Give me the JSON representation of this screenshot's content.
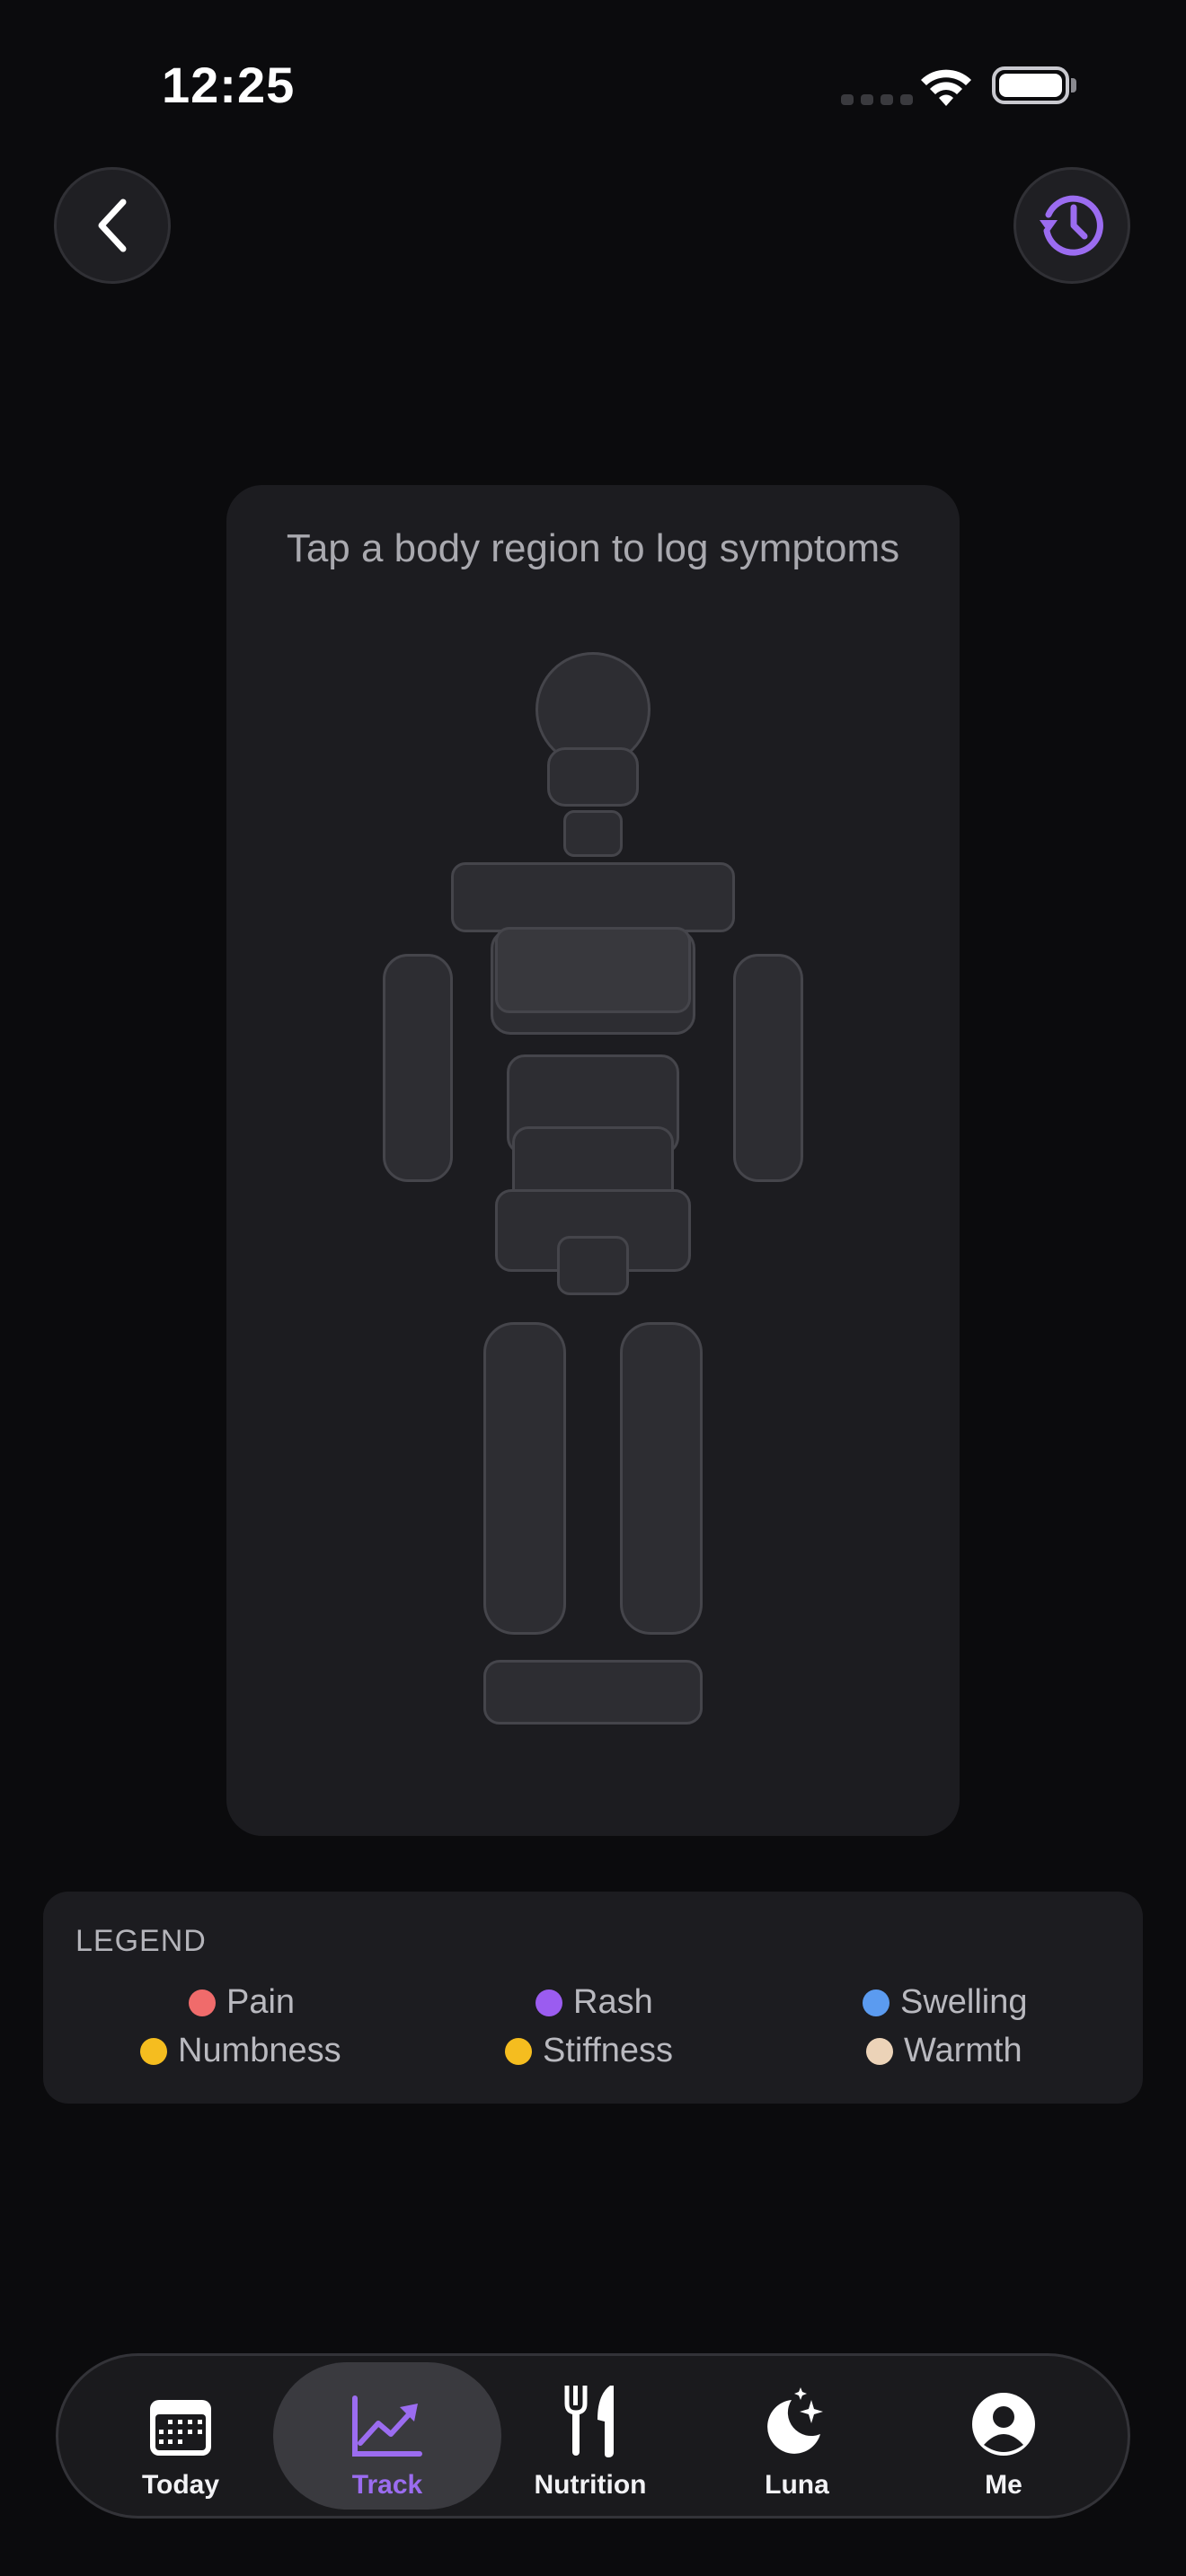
{
  "status": {
    "time": "12:25"
  },
  "header": {
    "back_icon": "chevron-left-icon",
    "history_icon": "history-icon"
  },
  "body_map": {
    "prompt": "Tap a body region to log symptoms"
  },
  "legend": {
    "title": "LEGEND",
    "items": [
      {
        "label": "Pain",
        "color": "#f06b6b"
      },
      {
        "label": "Rash",
        "color": "#9b5cf0"
      },
      {
        "label": "Swelling",
        "color": "#5b9bf0"
      },
      {
        "label": "Numbness",
        "color": "#f5bd1f"
      },
      {
        "label": "Stiffness",
        "color": "#f5bd1f"
      },
      {
        "label": "Warmth",
        "color": "#ecd3b8"
      }
    ]
  },
  "tabs": [
    {
      "label": "Today",
      "icon": "calendar-icon"
    },
    {
      "label": "Track",
      "icon": "chart-trend-icon",
      "active": true
    },
    {
      "label": "Nutrition",
      "icon": "fork-knife-icon"
    },
    {
      "label": "Luna",
      "icon": "moon-stars-icon"
    },
    {
      "label": "Me",
      "icon": "profile-icon"
    }
  ],
  "colors": {
    "accent": "#9b6cf0",
    "background": "#0b0b0d",
    "card": "#1c1c20"
  }
}
